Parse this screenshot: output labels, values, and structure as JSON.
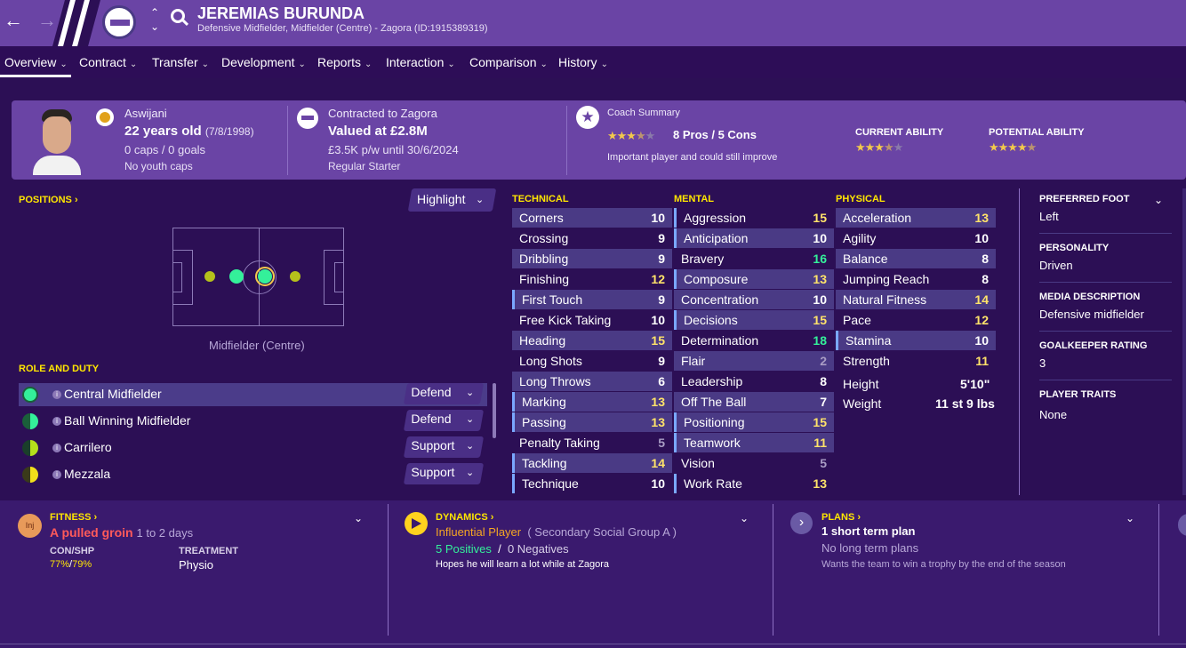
{
  "header": {
    "name": "JEREMIAS BURUNDA",
    "subtitle": "Defensive Midfielder, Midfielder (Centre) - Zagora (ID:1915389319)"
  },
  "nav": [
    {
      "label": "Overview"
    },
    {
      "label": "Contract"
    },
    {
      "label": "Transfer"
    },
    {
      "label": "Development"
    },
    {
      "label": "Reports"
    },
    {
      "label": "Interaction"
    },
    {
      "label": "Comparison"
    },
    {
      "label": "History"
    }
  ],
  "info": {
    "nation": "Aswijani",
    "age": "22 years old",
    "dob": "(7/8/1998)",
    "caps": "0 caps / 0 goals",
    "youth": "No youth caps",
    "contracted": "Contracted to Zagora",
    "value": "Valued at £2.8M",
    "wage": "£3.5K p/w until 30/6/2024",
    "status": "Regular Starter",
    "coach_title": "Coach Summary",
    "pros_cons": "8 Pros / 5 Cons",
    "coach_note": "Important player and could still improve",
    "current_ability_label": "CURRENT ABILITY",
    "potential_ability_label": "POTENTIAL ABILITY",
    "coach_stars": 3.5,
    "current_stars": 3.5,
    "potential_stars": 4.5
  },
  "positions": {
    "title": "POSITIONS",
    "highlight": "Highlight",
    "position_label": "Midfielder (Centre)"
  },
  "roles": {
    "title": "ROLE AND DUTY",
    "items": [
      {
        "role": "Central Midfielder",
        "duty": "Defend"
      },
      {
        "role": "Ball Winning Midfielder",
        "duty": "Defend"
      },
      {
        "role": "Carrilero",
        "duty": "Support"
      },
      {
        "role": "Mezzala",
        "duty": "Support"
      }
    ]
  },
  "technical": {
    "title": "TECHNICAL",
    "rows": [
      {
        "name": "Corners",
        "value": "10"
      },
      {
        "name": "Crossing",
        "value": "9"
      },
      {
        "name": "Dribbling",
        "value": "9"
      },
      {
        "name": "Finishing",
        "value": "12"
      },
      {
        "name": "First Touch",
        "value": "9"
      },
      {
        "name": "Free Kick Taking",
        "value": "10"
      },
      {
        "name": "Heading",
        "value": "15"
      },
      {
        "name": "Long Shots",
        "value": "9"
      },
      {
        "name": "Long Throws",
        "value": "6"
      },
      {
        "name": "Marking",
        "value": "13"
      },
      {
        "name": "Passing",
        "value": "13"
      },
      {
        "name": "Penalty Taking",
        "value": "5"
      },
      {
        "name": "Tackling",
        "value": "14"
      },
      {
        "name": "Technique",
        "value": "10"
      }
    ]
  },
  "mental": {
    "title": "MENTAL",
    "rows": [
      {
        "name": "Aggression",
        "value": "15"
      },
      {
        "name": "Anticipation",
        "value": "10"
      },
      {
        "name": "Bravery",
        "value": "16"
      },
      {
        "name": "Composure",
        "value": "13"
      },
      {
        "name": "Concentration",
        "value": "10"
      },
      {
        "name": "Decisions",
        "value": "15"
      },
      {
        "name": "Determination",
        "value": "18"
      },
      {
        "name": "Flair",
        "value": "2"
      },
      {
        "name": "Leadership",
        "value": "8"
      },
      {
        "name": "Off The Ball",
        "value": "7"
      },
      {
        "name": "Positioning",
        "value": "15"
      },
      {
        "name": "Teamwork",
        "value": "11"
      },
      {
        "name": "Vision",
        "value": "5"
      },
      {
        "name": "Work Rate",
        "value": "13"
      }
    ]
  },
  "physical": {
    "title": "PHYSICAL",
    "rows": [
      {
        "name": "Acceleration",
        "value": "13"
      },
      {
        "name": "Agility",
        "value": "10"
      },
      {
        "name": "Balance",
        "value": "8"
      },
      {
        "name": "Jumping Reach",
        "value": "8"
      },
      {
        "name": "Natural Fitness",
        "value": "14"
      },
      {
        "name": "Pace",
        "value": "12"
      },
      {
        "name": "Stamina",
        "value": "10"
      },
      {
        "name": "Strength",
        "value": "11"
      }
    ],
    "height_label": "Height",
    "height": "5'10\"",
    "weight_label": "Weight",
    "weight": "11 st 9 lbs"
  },
  "side": {
    "foot_label": "PREFERRED FOOT",
    "foot": "Left",
    "personality_label": "PERSONALITY",
    "personality": "Driven",
    "media_label": "MEDIA DESCRIPTION",
    "media": "Defensive midfielder",
    "gk_label": "GOALKEEPER RATING",
    "gk": "3",
    "traits_label": "PLAYER TRAITS",
    "traits": "None"
  },
  "fitness": {
    "title": "FITNESS",
    "badge": "Inj",
    "injury": "A pulled groin",
    "duration": "1 to 2 days",
    "con_label": "CON/SHP",
    "con": "77%",
    "shp": "79%",
    "treatment_label": "TREATMENT",
    "treatment": "Physio"
  },
  "dynamics": {
    "title": "DYNAMICS",
    "role": "Influential Player",
    "group": "( Secondary Social Group A )",
    "positives": "5 Positives",
    "negatives": "0 Negatives",
    "hope": "Hopes he will learn a lot while at Zagora"
  },
  "plans": {
    "title": "PLANS",
    "plan": "1 short term plan",
    "long": "No long term plans",
    "wants": "Wants the team to win a trophy by the end of the season"
  },
  "colors": {
    "accent": "#ffe600",
    "header": "#6a44a5",
    "bg": "#2c0f55",
    "green": "#34f09a"
  }
}
